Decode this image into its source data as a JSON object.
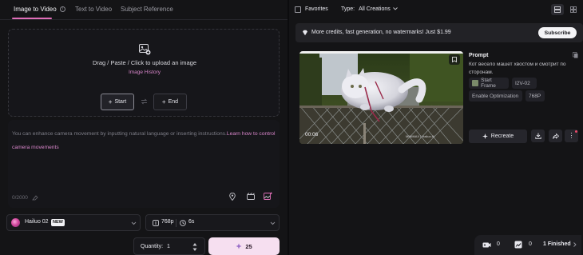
{
  "tabs": [
    {
      "label": "Image to Video",
      "active": true
    },
    {
      "label": "Text to Video",
      "active": false
    },
    {
      "label": "Subject Reference",
      "active": false
    }
  ],
  "upload": {
    "instruction": "Drag / Paste / Click to upload an image",
    "history_link": "Image History"
  },
  "frames": {
    "start_label": "Start",
    "end_label": "End"
  },
  "prompt": {
    "placeholder_text": "You can enhance camera movement by inputting natural language or inserting instructions.",
    "learn_link": "Learn how to control camera movements",
    "counter": "0/2000"
  },
  "model": {
    "name": "Hailuo 02",
    "badge": "NEW"
  },
  "settings": {
    "resolution": "768p",
    "duration": "6s"
  },
  "quantity": {
    "label": "Quantity:",
    "value": "1"
  },
  "generate": {
    "cost": "25"
  },
  "filters": {
    "favorites_label": "Favorites",
    "type_label": "Type:",
    "type_value": "All Creations"
  },
  "banner": {
    "text": "More credits, fast generation, no watermarks! Just $1.99",
    "subscribe_label": "Subscribe"
  },
  "video": {
    "time": "00:06",
    "watermark": "MINIMAX | Hailuo AI",
    "prompt_title": "Prompt",
    "prompt_text": "Кот весело машет хвостом и смотрит по сторонам.",
    "start_frame_label": "Start Frame",
    "model_tag": "I2V-02",
    "optimization_tag": "Enable Optimization",
    "resolution_tag": "768P",
    "recreate_label": "Recreate"
  },
  "status": {
    "count_a": "0",
    "count_b": "0",
    "finished": "1 Finished"
  },
  "colors": {
    "accent": "#e06eb8",
    "generate_bg": "#f6dff0",
    "background": "#121214"
  }
}
